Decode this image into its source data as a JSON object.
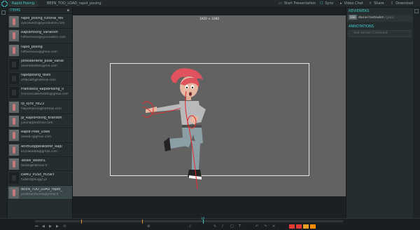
{
  "topbar": {
    "tabs": [
      "Rapid Posing",
      "BEEN_TOO_LOAD_rapid_posing"
    ],
    "actions": [
      {
        "icon": "present-icon",
        "label": "Start Presentation"
      },
      {
        "icon": "sync-icon",
        "label": "Sync"
      },
      {
        "icon": "video-chat-icon",
        "label": "Video Chat"
      },
      {
        "icon": "share-icon",
        "label": "Share"
      },
      {
        "icon": "download-icon",
        "label": "Download"
      }
    ]
  },
  "items_panel": {
    "title": "ITEMS",
    "items": [
      {
        "title": "rapid_posing_tutorial_rev",
        "subtitle": "syncsketch@syncsketch.com",
        "thumb": "img"
      },
      {
        "title": "RapidPosing_Variation",
        "subtitle": "hifflesmove@syncsketch.com",
        "thumb": "img"
      },
      {
        "title": "rapid_posing",
        "subtitle": "hifflesmove@gmail.com",
        "thumb": "img"
      },
      {
        "title": "jonesberlene_pose_variat",
        "subtitle": "lanimatedtom@me.com",
        "thumb": "video"
      },
      {
        "title": "rapidposing_tests",
        "subtitle": "vmbcwtt@hotmail.com",
        "thumb": "video"
      },
      {
        "title": "Francesca_RapidPosing_0",
        "subtitle": "francescaBertolotti@gmail.com",
        "thumb": "video"
      },
      {
        "title": "rp_sync_fst23",
        "subtitle": "fillipemarino@hotmail.com",
        "thumb": "img"
      },
      {
        "title": "jp_RapidPosing_Brandon",
        "subtitle": "juliana@hotmail.com",
        "thumb": "img"
      },
      {
        "title": "Rapid Pose_Doee",
        "subtitle": "doee87@gmail.com",
        "thumb": "img"
      },
      {
        "title": "AnimDoppelwoefer_Rapi",
        "subtitle": "kschwoebel@gmail.com",
        "thumb": "img"
      },
      {
        "title": "Tessie_lesson1",
        "subtitle": "tessie@hotmail.fr",
        "thumb": "img"
      },
      {
        "title": "EAMO_POSE_HUSKY",
        "subtitle": "hubert@nuggs.pl",
        "thumb": "video"
      },
      {
        "title": "BEEN_TOO_LOAD_rapid_",
        "subtitle": "jonathanmcneil@ymail.fr",
        "thumb": "img"
      }
    ]
  },
  "viewer": {
    "resolution": "1920 × 1080",
    "background": "#626262"
  },
  "reviewers_panel": {
    "title": "REVIEWERS",
    "reviewer_tag": "SSB",
    "reviewer_name": "daniel testsubm",
    "reviewer_role": "(you)",
    "annotations_title": "ANNOTATIONS",
    "annotation_placeholder": "Add Version Comment"
  },
  "timeline": {
    "current_frame": "19",
    "accent": "#41c6c8",
    "marker_color": "#e48a2f",
    "swatches": [
      "#e53935",
      "#e53935",
      "#f0a020",
      "#fb8c00"
    ]
  },
  "colors": {
    "accent": "#41c6c8",
    "panel": "#262d2f",
    "annotation_stroke": "#e52727"
  }
}
